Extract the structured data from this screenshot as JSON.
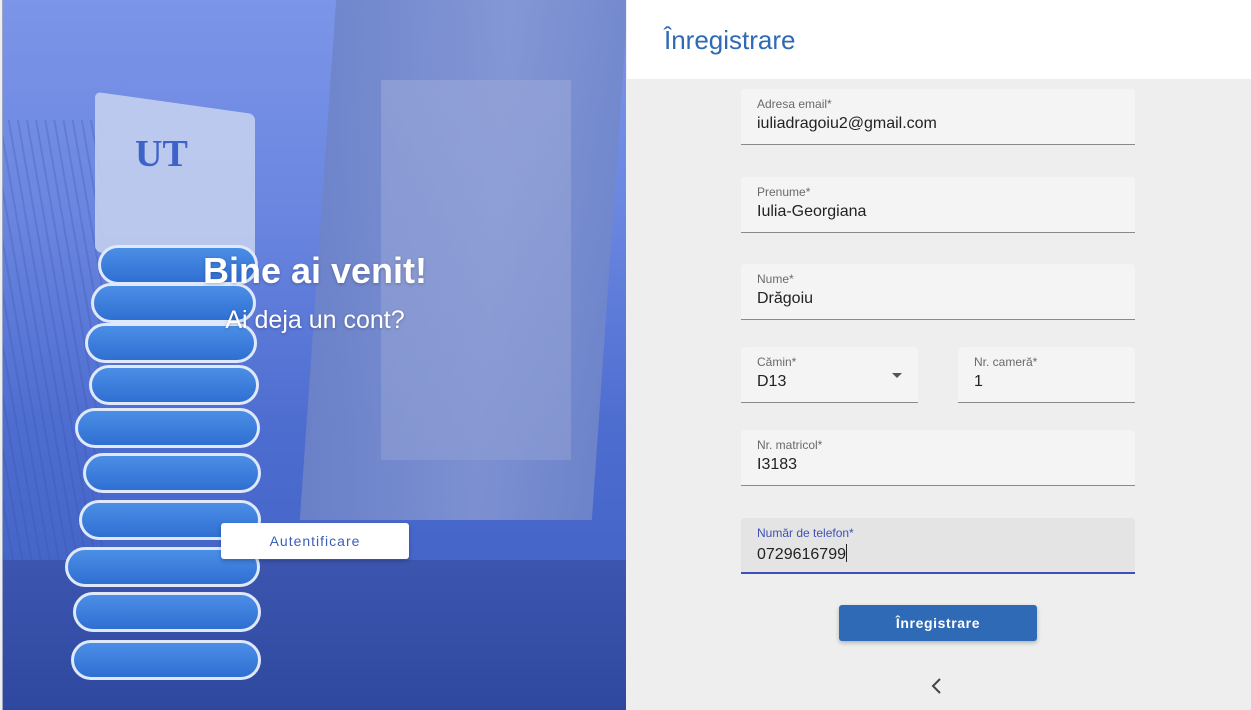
{
  "hero": {
    "title": "Bine ai venit!",
    "subtitle": "Ai deja un cont?",
    "login_button": "Autentificare",
    "background_color": "#5a78d8"
  },
  "form": {
    "title": "Înregistrare",
    "fields": {
      "email": {
        "label": "Adresa email*",
        "value": "iuliadragoiu2@gmail.com"
      },
      "first_name": {
        "label": "Prenume*",
        "value": "Iulia-Georgiana"
      },
      "last_name": {
        "label": "Nume*",
        "value": "Drăgoiu"
      },
      "dorm": {
        "label": "Cămin*",
        "value": "D13"
      },
      "room": {
        "label": "Nr. cameră*",
        "value": "1"
      },
      "student_id": {
        "label": "Nr. matricol*",
        "value": "I3183"
      },
      "phone": {
        "label": "Număr de telefon*",
        "value": "0729616799"
      }
    },
    "submit_button": "Înregistrare",
    "accent_color": "#2e6ab5",
    "focus_color": "#3f51b5",
    "back_icon": "chevron-left-icon"
  }
}
